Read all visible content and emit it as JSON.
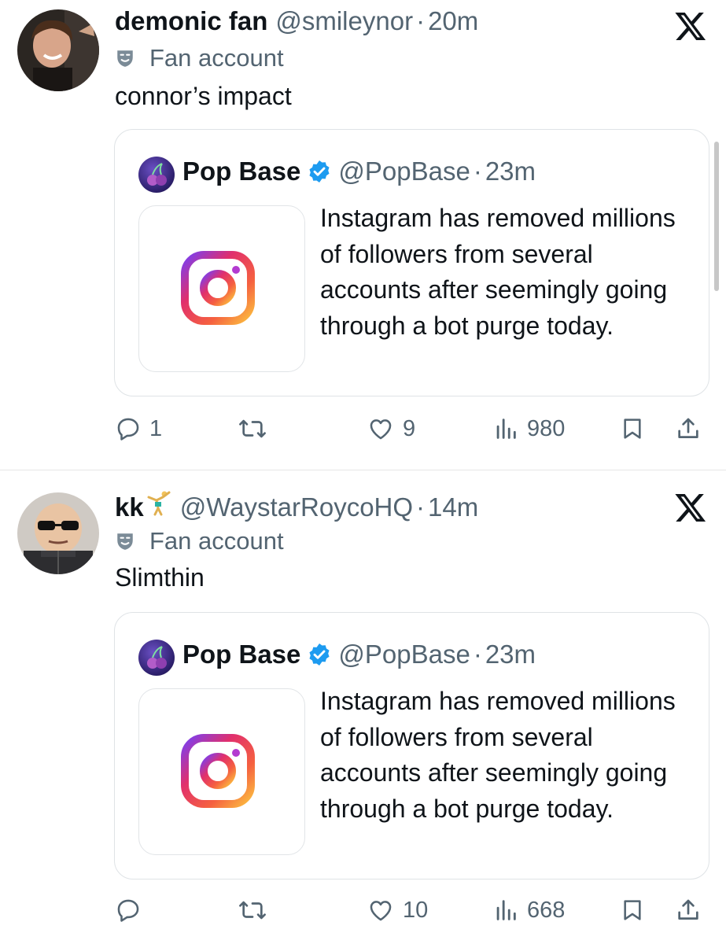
{
  "tweets": [
    {
      "display_name": "demonic fan",
      "handle": "@smileynor",
      "separator": "·",
      "time": "20m",
      "label": "Fan account",
      "text": "connor’s impact",
      "quote": {
        "display_name": "Pop Base",
        "handle": "@PopBase",
        "separator": "·",
        "time": "23m",
        "text": "Instagram has removed millions of followers from several accounts after seemingly going through a bot purge today."
      },
      "actions": {
        "replies": "1",
        "retweets": "",
        "likes": "9",
        "views": "980"
      }
    },
    {
      "display_name": "kk",
      "handle": "@WaystarRoycoHQ",
      "separator": "·",
      "time": "14m",
      "label": "Fan account",
      "text": "Slimthin",
      "quote": {
        "display_name": "Pop Base",
        "handle": "@PopBase",
        "separator": "·",
        "time": "23m",
        "text": "Instagram has removed millions of followers from several accounts after seemingly going through a bot purge today."
      },
      "actions": {
        "replies": "",
        "retweets": "",
        "likes": "10",
        "views": "668"
      }
    }
  ],
  "icons": {
    "reply": "reply-icon",
    "retweet": "retweet-icon",
    "like": "heart-icon",
    "views": "views-icon",
    "bookmark": "bookmark-icon",
    "share": "share-icon",
    "platform": "x-logo-icon",
    "label": "theater-mask-icon",
    "verified": "verified-badge-icon",
    "quote_media": "instagram-logo-icon"
  },
  "colors": {
    "text": "#0f1419",
    "secondary": "#536471",
    "verified": "#1d9bf0",
    "border": "#dfe3e6"
  }
}
